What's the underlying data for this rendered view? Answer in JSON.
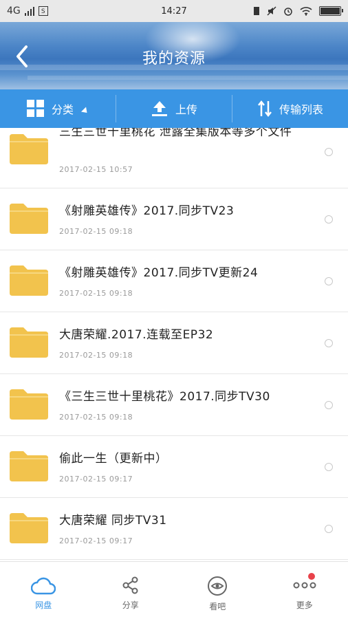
{
  "status_bar": {
    "network": "4G",
    "time": "14:27"
  },
  "header": {
    "title": "我的资源"
  },
  "toolbar": {
    "category_label": "分类",
    "upload_label": "上传",
    "transfer_label": "传输列表"
  },
  "files": [
    {
      "name": "三生三世十里桃花 泄露全集版本等多个文件",
      "date": "2017-02-15  10:57"
    },
    {
      "name": "《射雕英雄传》2017.同步TV23",
      "date": "2017-02-15  09:18"
    },
    {
      "name": "《射雕英雄传》2017.同步TV更新24",
      "date": "2017-02-15  09:18"
    },
    {
      "name": "大唐荣耀.2017.连载至EP32",
      "date": "2017-02-15  09:18"
    },
    {
      "name": "《三生三世十里桃花》2017.同步TV30",
      "date": "2017-02-15  09:18"
    },
    {
      "name": "偷此一生（更新中）",
      "date": "2017-02-15  09:17"
    },
    {
      "name": "大唐荣耀 同步TV31",
      "date": "2017-02-15  09:17"
    }
  ],
  "bottom_nav": {
    "items": [
      {
        "label": "网盘",
        "icon": "cloud-icon",
        "active": true
      },
      {
        "label": "分享",
        "icon": "share-icon"
      },
      {
        "label": "看吧",
        "icon": "eye-icon"
      },
      {
        "label": "更多",
        "icon": "more-dots-icon",
        "badge": true
      }
    ]
  },
  "colors": {
    "accent": "#3a95e4",
    "folder": "#f2c34d",
    "badge": "#e8424a"
  }
}
